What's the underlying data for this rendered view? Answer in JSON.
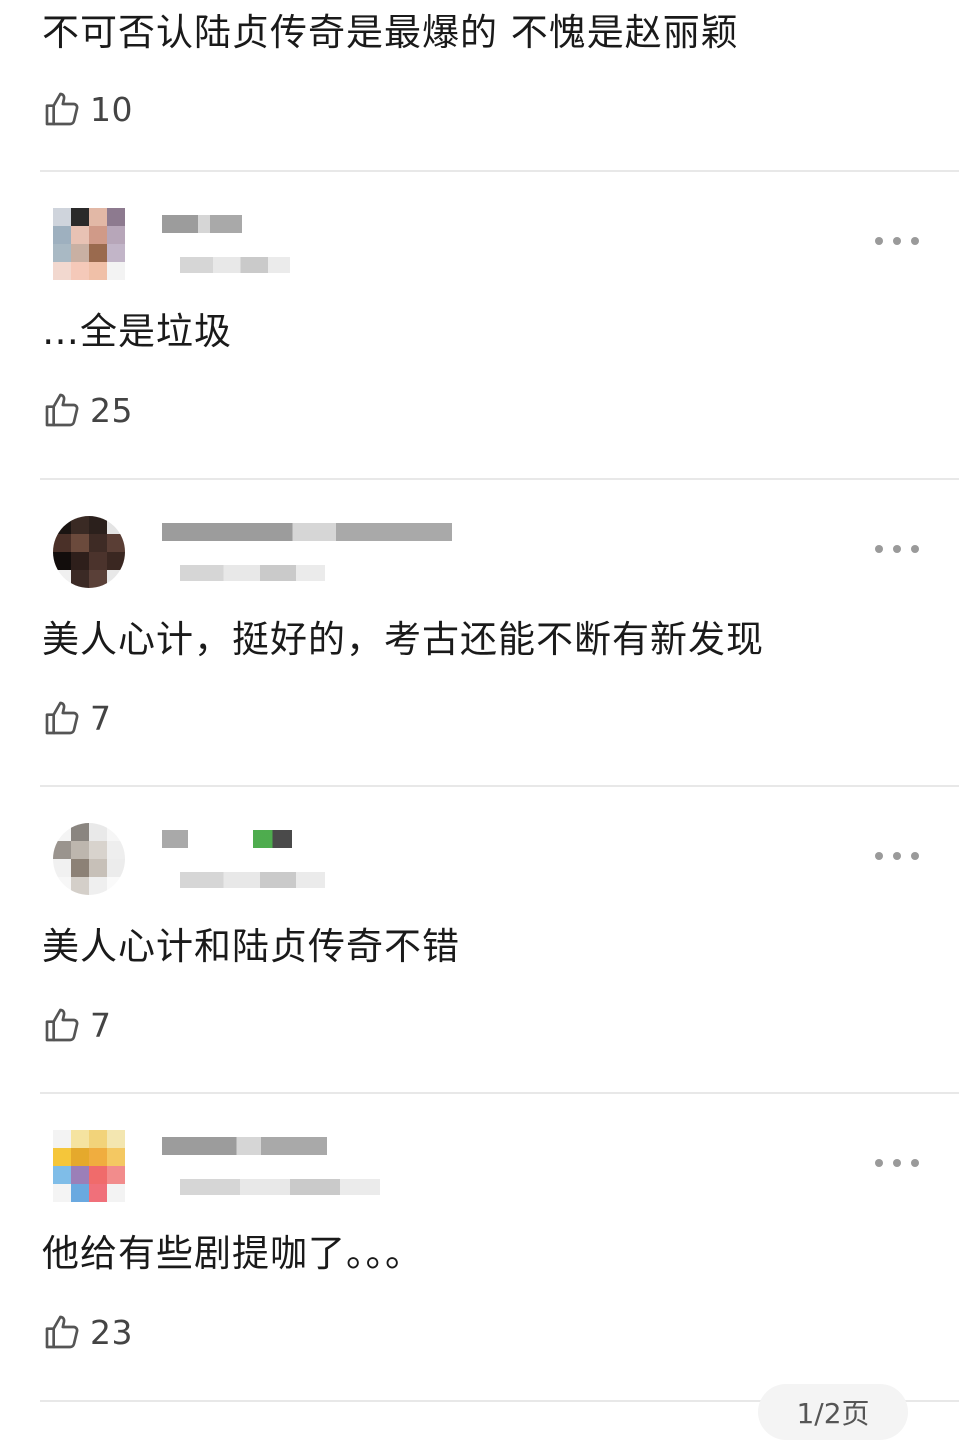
{
  "comments": [
    {
      "text": "不可否认陆贞传奇是最爆的 不愧是赵丽颖",
      "likes": "10"
    },
    {
      "text": "…全是垃圾",
      "likes": "25"
    },
    {
      "text": "美人心计，挺好的，考古还能不断有新发现",
      "likes": "7"
    },
    {
      "text": "美人心计和陆贞传奇不错",
      "likes": "7"
    },
    {
      "text": "他给有些剧提咖了。。。",
      "likes": "23"
    }
  ],
  "page_indicator": "1/2页",
  "colors": {
    "text": "#1a1a1a",
    "like_icon": "#555555",
    "divider": "#e8e8e8",
    "more_dots": "#9a9a9a"
  },
  "icons": {
    "like": "thumbs-up-icon",
    "more": "ellipsis-icon"
  }
}
